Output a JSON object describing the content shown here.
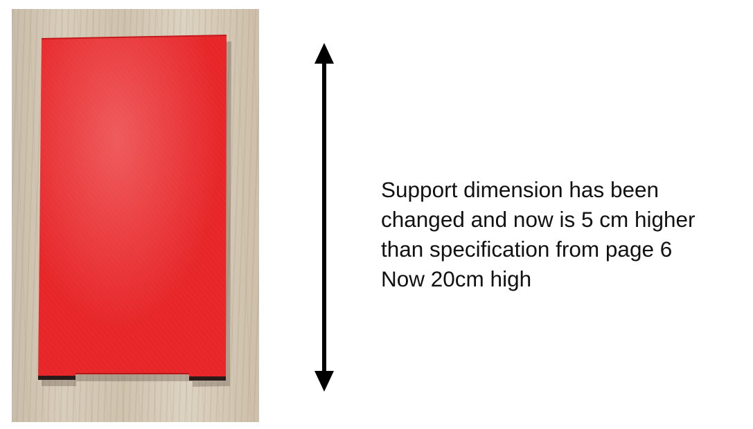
{
  "caption": {
    "lines": [
      "Support dimension has been",
      "changed and now is 5 cm higher",
      "than specification from page 6",
      "Now 20cm high"
    ]
  },
  "photo": {
    "subject": "red-support-plate",
    "support_color": "#e8282b",
    "background_color": "#d3c7b3"
  },
  "arrow": {
    "color": "#000000"
  }
}
